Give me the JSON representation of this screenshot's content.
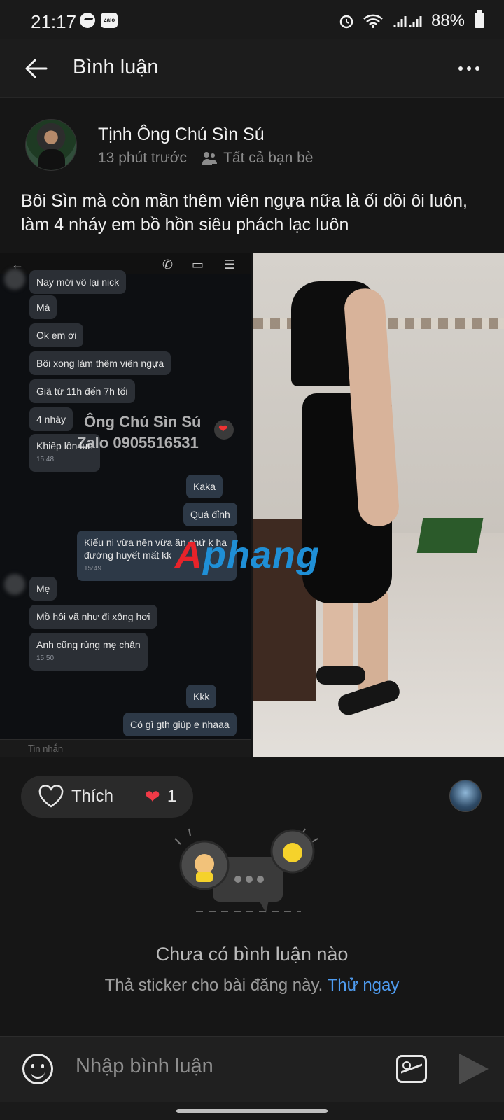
{
  "status_bar": {
    "time": "21:17",
    "battery": "88%",
    "zalo_badge": "Zalo"
  },
  "header": {
    "title": "Bình luận"
  },
  "post": {
    "author": "Tịnh Ông Chú Sìn Sú",
    "time": "13 phút trước",
    "audience": "Tất cả bạn bè",
    "caption": "Bôi Sìn mà còn mần thêm viên ngựa nữa là ối dồi ôi luôn, làm 4 nháy em bồ hồn siêu phách lạc luôn"
  },
  "chat_screenshot": {
    "messages": [
      {
        "text": "Nay mới vô lại nick",
        "from": "them"
      },
      {
        "text": "Má",
        "from": "them"
      },
      {
        "text": "Ok em ơi",
        "from": "them"
      },
      {
        "text": "Bôi xong làm thêm viên ngựa",
        "from": "them"
      },
      {
        "text": "Giã từ 11h đến 7h tối",
        "from": "them"
      },
      {
        "text": "4 nháy",
        "from": "them"
      },
      {
        "text": "Khiếp lồn lun",
        "from": "them",
        "time": "15:48"
      },
      {
        "text": "Kaka",
        "from": "me"
      },
      {
        "text": "Quá đỉnh",
        "from": "me"
      },
      {
        "text": "Kiểu ni vừa nện vừa ăn chứ k hạ đường huyết mất kk",
        "from": "me",
        "time": "15:49"
      },
      {
        "text": "Mẹ",
        "from": "them"
      },
      {
        "text": "Mồ hôi vã như đi xông hơi",
        "from": "them"
      },
      {
        "text": "Anh cũng rùng mẹ chân",
        "from": "them",
        "time": "15:50"
      },
      {
        "text": "Kkk",
        "from": "me"
      },
      {
        "text": "Có gì gth giúp e nhaaa",
        "from": "me"
      }
    ],
    "watermark_line1": "Ông Chú Sìn Sú",
    "watermark_line2": "Zalo 0905516531",
    "logo_part1": "A",
    "logo_part2": "phang",
    "input_placeholder": "Tin nhắn"
  },
  "actions": {
    "like_label": "Thích",
    "reaction_count": "1"
  },
  "empty_state": {
    "title": "Chưa có bình luận nào",
    "subtitle": "Thả sticker cho bài đăng này.",
    "link": "Thử ngay"
  },
  "composer": {
    "placeholder": "Nhập bình luận"
  },
  "colors": {
    "background": "#161616",
    "link": "#4f9cf0",
    "heart": "#f03a47",
    "logo_red": "#e8232a",
    "logo_blue": "#1f8fd6"
  }
}
